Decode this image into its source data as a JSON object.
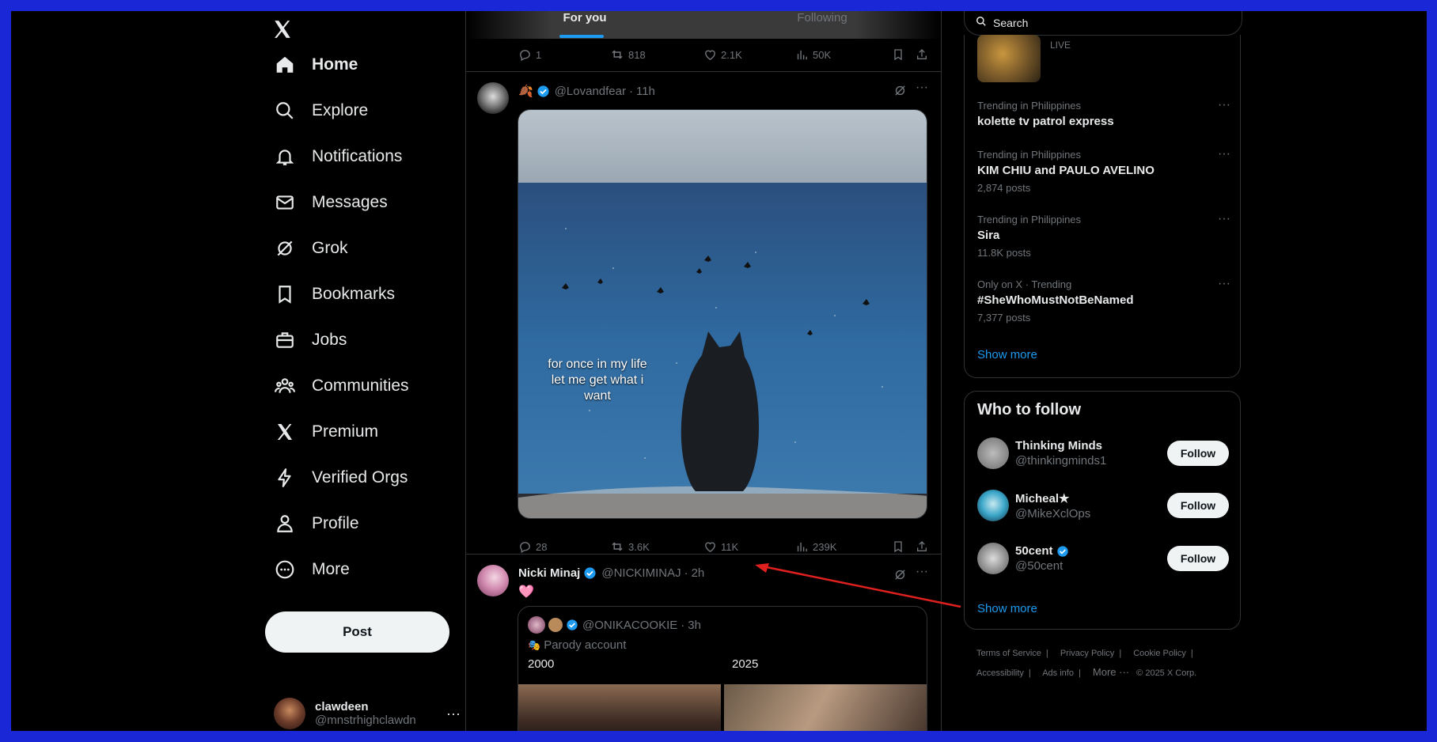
{
  "nav": {
    "items": [
      {
        "label": "Home",
        "icon": "home-icon"
      },
      {
        "label": "Explore",
        "icon": "search-icon"
      },
      {
        "label": "Notifications",
        "icon": "bell-icon"
      },
      {
        "label": "Messages",
        "icon": "envelope-icon"
      },
      {
        "label": "Grok",
        "icon": "grok-icon"
      },
      {
        "label": "Bookmarks",
        "icon": "bookmark-icon"
      },
      {
        "label": "Jobs",
        "icon": "briefcase-icon"
      },
      {
        "label": "Communities",
        "icon": "people-icon"
      },
      {
        "label": "Premium",
        "icon": "x-logo-icon"
      },
      {
        "label": "Verified Orgs",
        "icon": "lightning-icon"
      },
      {
        "label": "Profile",
        "icon": "person-icon"
      },
      {
        "label": "More",
        "icon": "more-circle-icon"
      }
    ],
    "post_label": "Post",
    "account": {
      "name": "clawdeen",
      "handle": "@mnstrhighclawdn"
    }
  },
  "timeline": {
    "tabs": [
      {
        "label": "For you"
      },
      {
        "label": "Following"
      }
    ],
    "top_actions": {
      "replies": "1",
      "reposts": "818",
      "likes": "2.1K",
      "views": "50K"
    },
    "tweet1": {
      "emoji": "🍂",
      "handle": "@Lovandfear",
      "time": "11h",
      "caption": [
        "for once in my life",
        "let me get what i",
        "want"
      ],
      "replies": "28",
      "reposts": "3.6K",
      "likes": "11K",
      "views": "239K"
    },
    "tweet2": {
      "name": "Nicki Minaj",
      "handle": "@NICKIMINAJ",
      "time": "2h",
      "text": "🩷",
      "quote": {
        "handle": "@ONIKACOOKIE",
        "time": "3h",
        "parody": "Parody account",
        "left_label": "2000",
        "right_label": "2025"
      }
    }
  },
  "right": {
    "search_placeholder": "Search",
    "live_label": "LIVE",
    "trends": [
      {
        "context": "Trending in Philippines",
        "title": "kolette tv patrol express",
        "count": ""
      },
      {
        "context": "Trending in Philippines",
        "title": "KIM CHIU and PAULO AVELINO",
        "count": "2,874 posts"
      },
      {
        "context": "Trending in Philippines",
        "title": "Sira",
        "count": "11.8K posts"
      },
      {
        "context": "Only on X · Trending",
        "title": "#SheWhoMustNotBeNamed",
        "count": "7,377 posts"
      }
    ],
    "show_more": "Show more",
    "who_to_follow": {
      "title": "Who to follow",
      "follow_label": "Follow",
      "accounts": [
        {
          "name": "Thinking Minds",
          "handle": "@thinkingminds1",
          "verified": false
        },
        {
          "name": "Micheal★",
          "handle": "@MikeXclOps",
          "verified": false
        },
        {
          "name": "50cent",
          "handle": "@50cent",
          "verified": true
        }
      ],
      "show_more": "Show more"
    },
    "footer": {
      "links": [
        "Terms of Service",
        "Privacy Policy",
        "Cookie Policy",
        "Accessibility",
        "Ads info",
        "More ···"
      ],
      "copyright": "© 2025 X Corp."
    }
  },
  "colors": {
    "accent": "#1d9bf0",
    "background": "#000000",
    "frame": "#1a27d6",
    "annotation_arrow": "#e0201f"
  }
}
